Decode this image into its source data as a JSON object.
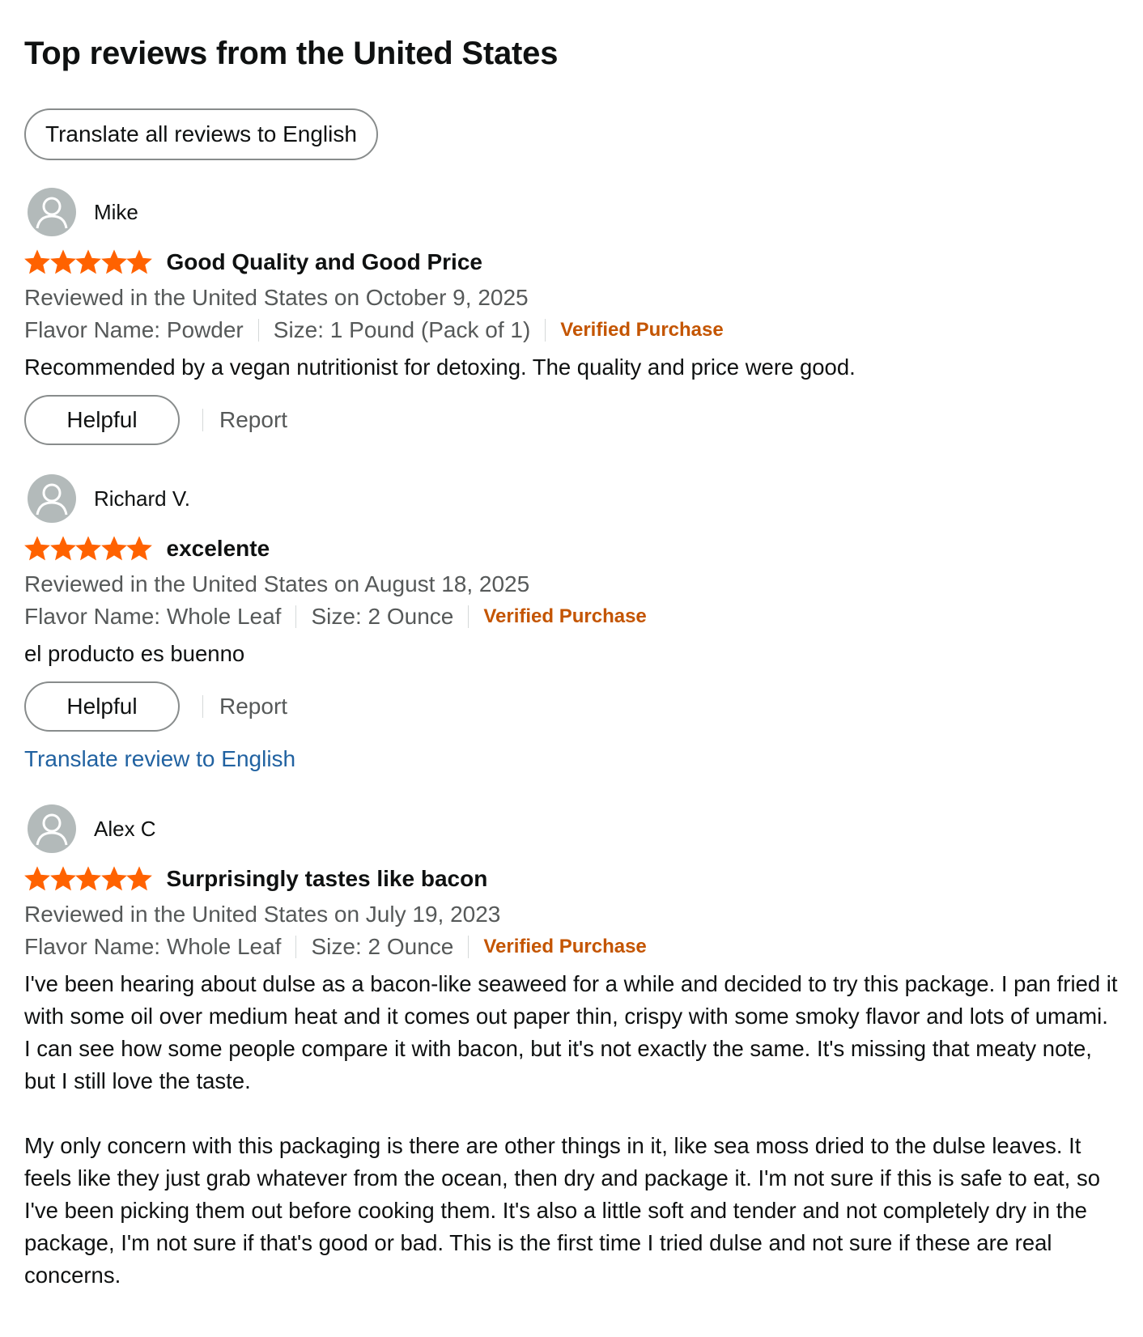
{
  "header": {
    "title": "Top reviews from the United States",
    "translate_all_label": "Translate all reviews to English"
  },
  "colors": {
    "star": "#ff6200",
    "verified": "#c45500",
    "link": "#2162a1",
    "avatar_bg": "#b3baba"
  },
  "reviews": [
    {
      "name": "Mike",
      "rating": 5,
      "title": "Good Quality and Good Price",
      "date": "Reviewed in the United States on October 9, 2025",
      "flavor": "Flavor Name: Powder",
      "size": "Size: 1 Pound (Pack of 1)",
      "verified": "Verified Purchase",
      "body": [
        "Recommended by a vegan nutritionist for detoxing. The quality and price were good."
      ],
      "helpful_label": "Helpful",
      "report_label": "Report"
    },
    {
      "name": "Richard V.",
      "rating": 5,
      "title": "excelente",
      "date": "Reviewed in the United States on August 18, 2025",
      "flavor": "Flavor Name: Whole Leaf",
      "size": "Size: 2 Ounce",
      "verified": "Verified Purchase",
      "body": [
        "el producto es buenno"
      ],
      "helpful_label": "Helpful",
      "report_label": "Report",
      "translate_label": "Translate review to English"
    },
    {
      "name": "Alex C",
      "rating": 5,
      "title": "Surprisingly tastes like bacon",
      "date": "Reviewed in the United States on July 19, 2023",
      "flavor": "Flavor Name: Whole Leaf",
      "size": "Size: 2 Ounce",
      "verified": "Verified Purchase",
      "body": [
        "I've been hearing about dulse as a bacon-like seaweed for a while and decided to try this package. I pan fried it with some oil over medium heat and it comes out paper thin, crispy with some smoky flavor and lots of umami. I can see how some people compare it with bacon, but it's not exactly the same. It's missing that meaty note, but I still love the taste.",
        "My only concern with this packaging is there are other things in it, like sea moss dried to the dulse leaves. It feels like they just grab whatever from the ocean, then dry and package it. I'm not sure if this is safe to eat, so I've been picking them out before cooking them. It's also a little soft and tender and not completely dry in the package, I'm not sure if that's good or bad. This is the first time I tried dulse and not sure if these are real concerns."
      ]
    }
  ]
}
